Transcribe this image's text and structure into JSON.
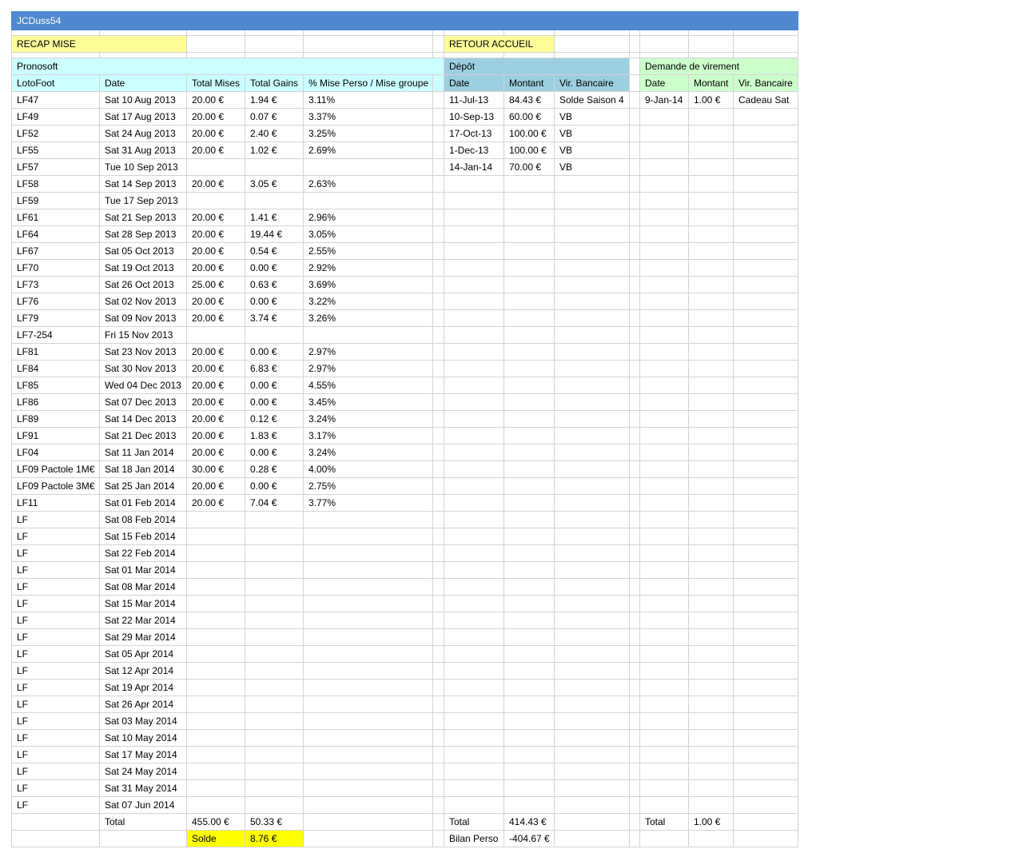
{
  "title": "JCDuss54",
  "buttons": {
    "recap": "RECAP MISE",
    "accueil": "RETOUR ACCUEIL"
  },
  "colors": {
    "title_bar": "#4f88cf",
    "recap_bg": "#ffff99",
    "pronosoft_bg": "#ccffff",
    "depot_bg": "#9ccfe0",
    "virement_bg": "#ccffcc",
    "solde_bg": "#ffff00"
  },
  "pronosoft": {
    "header": "Pronosoft",
    "columns": [
      "LotoFoot",
      "Date",
      "Total Mises",
      "Total Gains",
      "% Mise Perso / Mise groupe"
    ],
    "rows": [
      [
        "LF47",
        "Sat 10 Aug 2013",
        "20.00 €",
        "1.94 €",
        "3.11%"
      ],
      [
        "LF49",
        "Sat 17 Aug 2013",
        "20.00 €",
        "0.07 €",
        "3.37%"
      ],
      [
        "LF52",
        "Sat 24 Aug 2013",
        "20.00 €",
        "2.40 €",
        "3.25%"
      ],
      [
        "LF55",
        "Sat 31 Aug 2013",
        "20.00 €",
        "1.02 €",
        "2.69%"
      ],
      [
        "LF57",
        "Tue 10 Sep 2013",
        "",
        "",
        ""
      ],
      [
        "LF58",
        "Sat 14 Sep 2013",
        "20.00 €",
        "3.05 €",
        "2.63%"
      ],
      [
        "LF59",
        "Tue 17 Sep 2013",
        "",
        "",
        ""
      ],
      [
        "LF61",
        "Sat 21 Sep 2013",
        "20.00 €",
        "1.41 €",
        "2.96%"
      ],
      [
        "LF64",
        "Sat 28 Sep 2013",
        "20.00 €",
        "19.44 €",
        "3.05%"
      ],
      [
        "LF67",
        "Sat 05 Oct 2013",
        "20.00 €",
        "0.54 €",
        "2.55%"
      ],
      [
        "LF70",
        "Sat 19 Oct 2013",
        "20.00 €",
        "0.00 €",
        "2.92%"
      ],
      [
        "LF73",
        "Sat 26 Oct 2013",
        "25.00 €",
        "0.63 €",
        "3.69%"
      ],
      [
        "LF76",
        "Sat 02 Nov 2013",
        "20.00 €",
        "0.00 €",
        "3.22%"
      ],
      [
        "LF79",
        "Sat 09 Nov 2013",
        "20.00 €",
        "3.74 €",
        "3.26%"
      ],
      [
        "LF7-254",
        "Fri 15 Nov 2013",
        "",
        "",
        ""
      ],
      [
        "LF81",
        "Sat 23 Nov 2013",
        "20.00 €",
        "0.00 €",
        "2.97%"
      ],
      [
        "LF84",
        "Sat 30 Nov 2013",
        "20.00 €",
        "6.83 €",
        "2.97%"
      ],
      [
        "LF85",
        "Wed 04 Dec 2013",
        "20.00 €",
        "0.00 €",
        "4.55%"
      ],
      [
        "LF86",
        "Sat 07 Dec 2013",
        "20.00 €",
        "0.00 €",
        "3.45%"
      ],
      [
        "LF89",
        "Sat 14 Dec 2013",
        "20.00 €",
        "0.12 €",
        "3.24%"
      ],
      [
        "LF91",
        "Sat 21 Dec 2013",
        "20.00 €",
        "1.83 €",
        "3.17%"
      ],
      [
        "LF04",
        "Sat 11 Jan 2014",
        "20.00 €",
        "0.00 €",
        "3.24%"
      ],
      [
        "LF09 Pactole 1M€",
        "Sat 18 Jan 2014",
        "30.00 €",
        "0.28 €",
        "4.00%"
      ],
      [
        "LF09 Pactole 3M€",
        "Sat 25 Jan 2014",
        "20.00 €",
        "0.00 €",
        "2.75%"
      ],
      [
        "LF11",
        "Sat 01 Feb 2014",
        "20.00 €",
        "7.04 €",
        "3.77%"
      ],
      [
        "LF",
        "Sat 08 Feb 2014",
        "",
        "",
        ""
      ],
      [
        "LF",
        "Sat 15 Feb 2014",
        "",
        "",
        ""
      ],
      [
        "LF",
        "Sat 22 Feb 2014",
        "",
        "",
        ""
      ],
      [
        "LF",
        "Sat 01 Mar 2014",
        "",
        "",
        ""
      ],
      [
        "LF",
        "Sat 08 Mar 2014",
        "",
        "",
        ""
      ],
      [
        "LF",
        "Sat 15 Mar 2014",
        "",
        "",
        ""
      ],
      [
        "LF",
        "Sat 22 Mar 2014",
        "",
        "",
        ""
      ],
      [
        "LF",
        "Sat 29 Mar 2014",
        "",
        "",
        ""
      ],
      [
        "LF",
        "Sat 05 Apr 2014",
        "",
        "",
        ""
      ],
      [
        "LF",
        "Sat 12 Apr 2014",
        "",
        "",
        ""
      ],
      [
        "LF",
        "Sat 19 Apr 2014",
        "",
        "",
        ""
      ],
      [
        "LF",
        "Sat 26 Apr 2014",
        "",
        "",
        ""
      ],
      [
        "LF",
        "Sat 03 May 2014",
        "",
        "",
        ""
      ],
      [
        "LF",
        "Sat 10 May 2014",
        "",
        "",
        ""
      ],
      [
        "LF",
        "Sat 17 May 2014",
        "",
        "",
        ""
      ],
      [
        "LF",
        "Sat 24 May 2014",
        "",
        "",
        ""
      ],
      [
        "LF",
        "Sat 31 May 2014",
        "",
        "",
        ""
      ],
      [
        "LF",
        "Sat 07 Jun 2014",
        "",
        "",
        ""
      ]
    ],
    "total_label": "Total",
    "total_mises": "455.00 €",
    "total_gains": "50.33 €",
    "solde_label": "Solde",
    "solde_value": "8.76 €"
  },
  "depot": {
    "header": "Dépôt",
    "columns": [
      "Date",
      "Montant",
      "Vir. Bancaire"
    ],
    "rows": [
      [
        "11-Jul-13",
        "84.43 €",
        "Solde Saison 4"
      ],
      [
        "10-Sep-13",
        "60.00 €",
        "VB"
      ],
      [
        "17-Oct-13",
        "100.00 €",
        "VB"
      ],
      [
        "1-Dec-13",
        "100.00 €",
        "VB"
      ],
      [
        "14-Jan-14",
        "70.00 €",
        "VB"
      ]
    ],
    "total_label": "Total",
    "total_value": "414.43 €",
    "bilan_label": "Bilan Perso",
    "bilan_value": "-404.67 €"
  },
  "virement": {
    "header": "Demande de virement",
    "columns": [
      "Date",
      "Montant",
      "Vir. Bancaire"
    ],
    "rows": [
      [
        "9-Jan-14",
        "1.00 €",
        "Cadeau Sat"
      ]
    ],
    "total_label": "Total",
    "total_value": "1.00 €"
  }
}
